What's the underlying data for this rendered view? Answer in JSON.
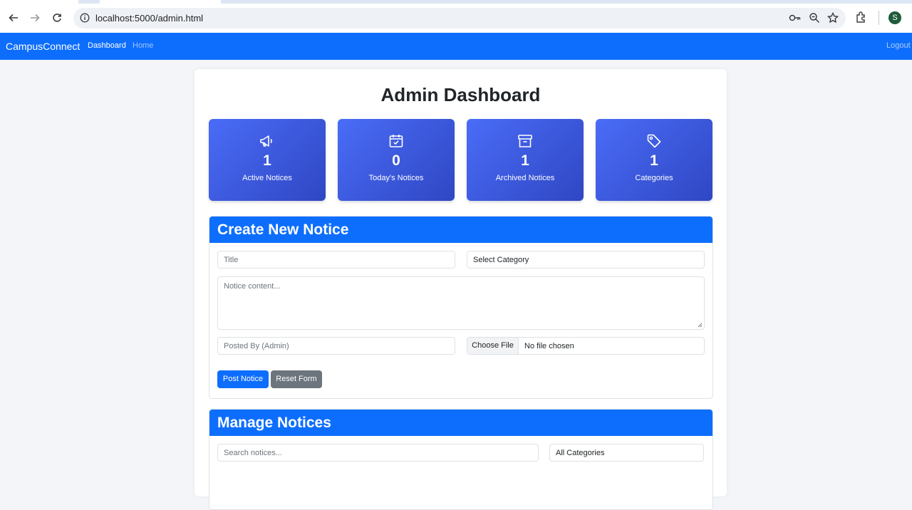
{
  "browser": {
    "url": "localhost:5000/admin.html",
    "profile_initial": "S"
  },
  "navbar": {
    "brand": "CampusConnect",
    "links": [
      "Dashboard",
      "Home"
    ],
    "logout": "Logout"
  },
  "page": {
    "title": "Admin Dashboard"
  },
  "stats": [
    {
      "icon": "megaphone-icon",
      "value": "1",
      "label": "Active Notices"
    },
    {
      "icon": "calendar-check-icon",
      "value": "0",
      "label": "Today's Notices"
    },
    {
      "icon": "archive-icon",
      "value": "1",
      "label": "Archived Notices"
    },
    {
      "icon": "tag-icon",
      "value": "1",
      "label": "Categories"
    }
  ],
  "create_form": {
    "heading": "Create New Notice",
    "title_placeholder": "Title",
    "category_selected": "Select Category",
    "content_placeholder": "Notice content...",
    "posted_by_placeholder": "Posted By (Admin)",
    "file_button": "Choose File",
    "file_status": "No file chosen",
    "post_button": "Post Notice",
    "reset_button": "Reset Form"
  },
  "manage": {
    "heading": "Manage Notices",
    "search_placeholder": "Search notices...",
    "category_filter": "All Categories"
  },
  "colors": {
    "primary": "#0d6efd",
    "secondary": "#6c757d",
    "stat_gradient_start": "#4a6cf7",
    "stat_gradient_end": "#2f47c3"
  }
}
